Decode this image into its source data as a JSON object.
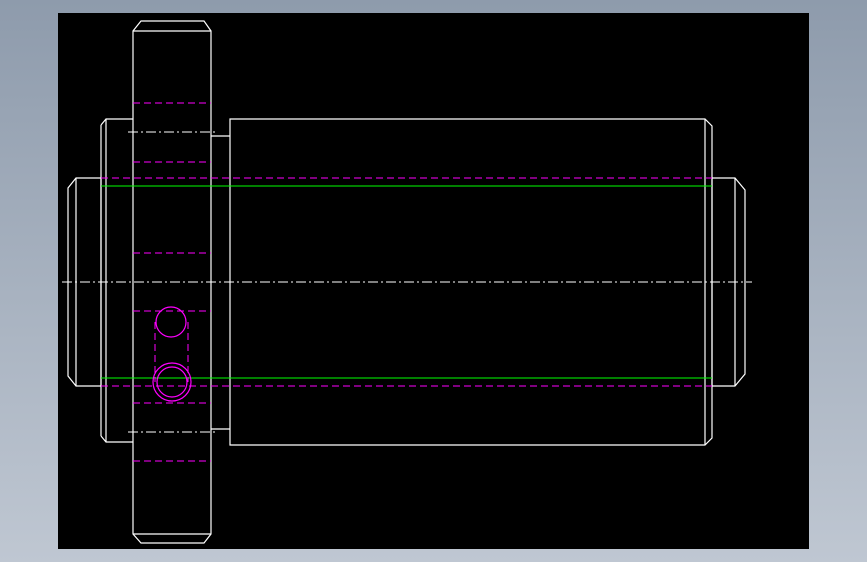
{
  "viewport": {
    "background_gradient": [
      "#8e9bac",
      "#bfc7d2"
    ],
    "canvas_color": "#000000"
  },
  "drawing": {
    "outline_color": "#ffffff",
    "hidden_line_color": "#ff00ff",
    "thread_line_color": "#00ff00",
    "centerline_color": "#ffffff",
    "views": [
      "flange",
      "body",
      "left-stub",
      "right-stub"
    ],
    "hole_count": 2
  }
}
